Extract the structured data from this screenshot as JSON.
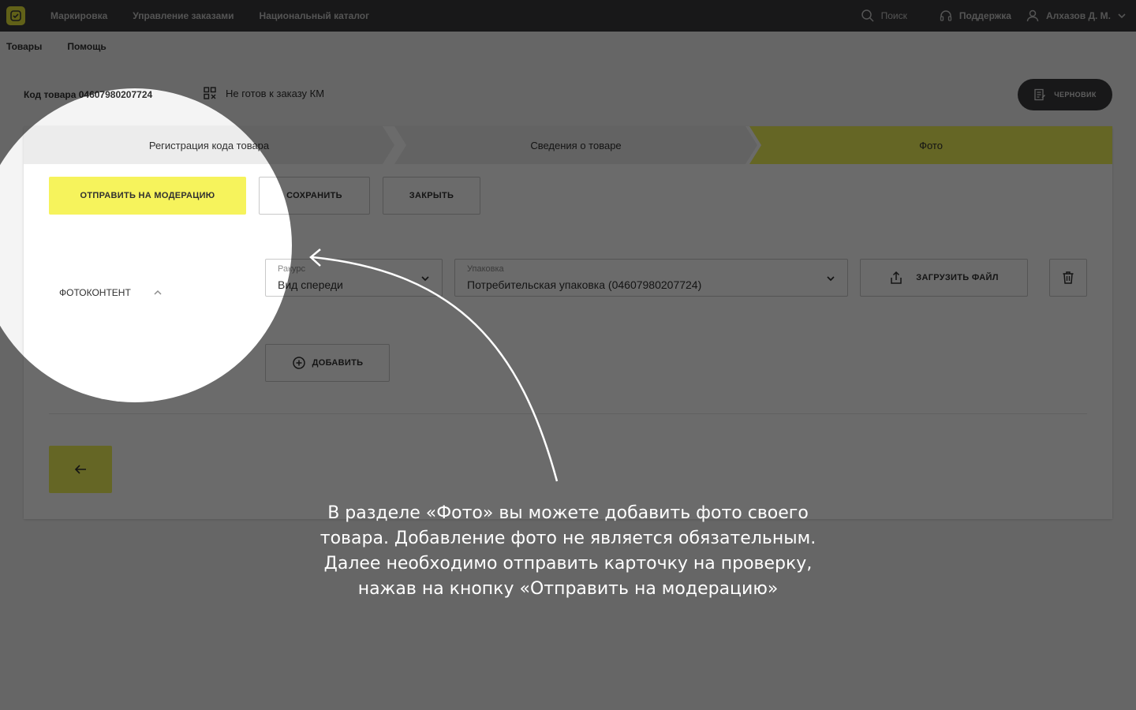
{
  "topbar": {
    "nav": [
      "Маркировка",
      "Управление заказами",
      "Национальный каталог"
    ],
    "search_label": "Поиск",
    "support_label": "Поддержка",
    "user_name": "Алхазов Д. М."
  },
  "subnav": [
    "Товары",
    "Помощь"
  ],
  "product": {
    "code_text": "Код товара 04607980207724",
    "status_text": "Не готов к заказу КМ",
    "draft_label": "ЧЕРНОВИК"
  },
  "steps": [
    "Регистрация кода товара",
    "Сведения о товаре",
    "Фото"
  ],
  "actions": {
    "moderation": "ОТПРАВИТЬ НА МОДЕРАЦИЮ",
    "save": "СОХРАНИТЬ",
    "close": "ЗАКРЫТЬ"
  },
  "photo_section": {
    "title": "ФОТОКОНТЕНТ",
    "angle": {
      "label": "Ракурс",
      "value": "Вид спереди"
    },
    "package": {
      "label": "Упаковка",
      "value": "Потребительская упаковка (04607980207724)"
    },
    "upload_label": "ЗАГРУЗИТЬ ФАЙЛ",
    "add_label": "ДОБАВИТЬ"
  },
  "tooltip": "В разделе «Фото» вы можете добавить фото своего товара. Добавление фото не является обязательным.  Далее необходимо отправить карточку на проверку, нажав на кнопку «Отправить на модерацию»",
  "colors": {
    "accent": "#f6f35c",
    "topbar": "#3a3b3d",
    "dim_overlay": "rgba(0,0,0,0.58)"
  }
}
